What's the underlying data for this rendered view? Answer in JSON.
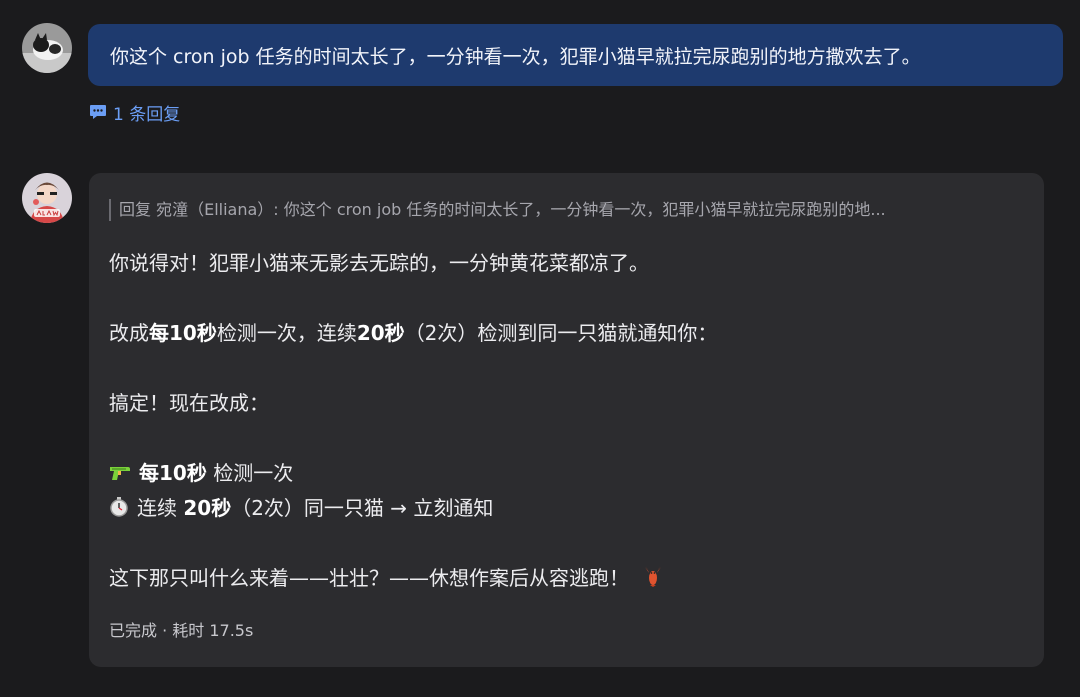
{
  "user_message": {
    "text": "你这个 cron job 任务的时间太长了，一分钟看一次，犯罪小猫早就拉完尿跑别的地方撒欢去了。",
    "reply_count_label": "1 条回复"
  },
  "bot_reply": {
    "quote": "回复 宛潼（Elliana）: 你这个 cron job 任务的时间太长了，一分钟看一次，犯罪小猫早就拉完尿跑别的地...",
    "line1": "你说得对！犯罪小猫来无影去无踪的，一分钟黄花菜都凉了。",
    "line2": {
      "p1": "改成",
      "b1": "每10秒",
      "p2": "检测一次，连续",
      "b2": "20秒",
      "p3": "（2次）检测到同一只猫就通知你："
    },
    "line3": "搞定！现在改成：",
    "bullet1": {
      "bold": "每10秒",
      "rest": " 检测一次"
    },
    "bullet2": {
      "pre": "连续 ",
      "bold": "20秒",
      "rest": "（2次）同一只猫 → 立刻通知"
    },
    "line4": "这下那只叫什么来着——壮壮？——休想作案后从容逃跑！",
    "status": "已完成 · 耗时 17.5s"
  },
  "icons": {
    "user_avatar": "cat-photo-avatar",
    "bot_avatar": "claw-avatar",
    "reply": "chat-bubble-icon",
    "bullet1": "water-gun-icon",
    "bullet2": "stopwatch-icon",
    "end": "lobster-icon"
  },
  "colors": {
    "background": "#1b1b1d",
    "user_bubble": "#1e3a6e",
    "bot_card": "#2c2c2f",
    "link": "#6b9ef5"
  }
}
